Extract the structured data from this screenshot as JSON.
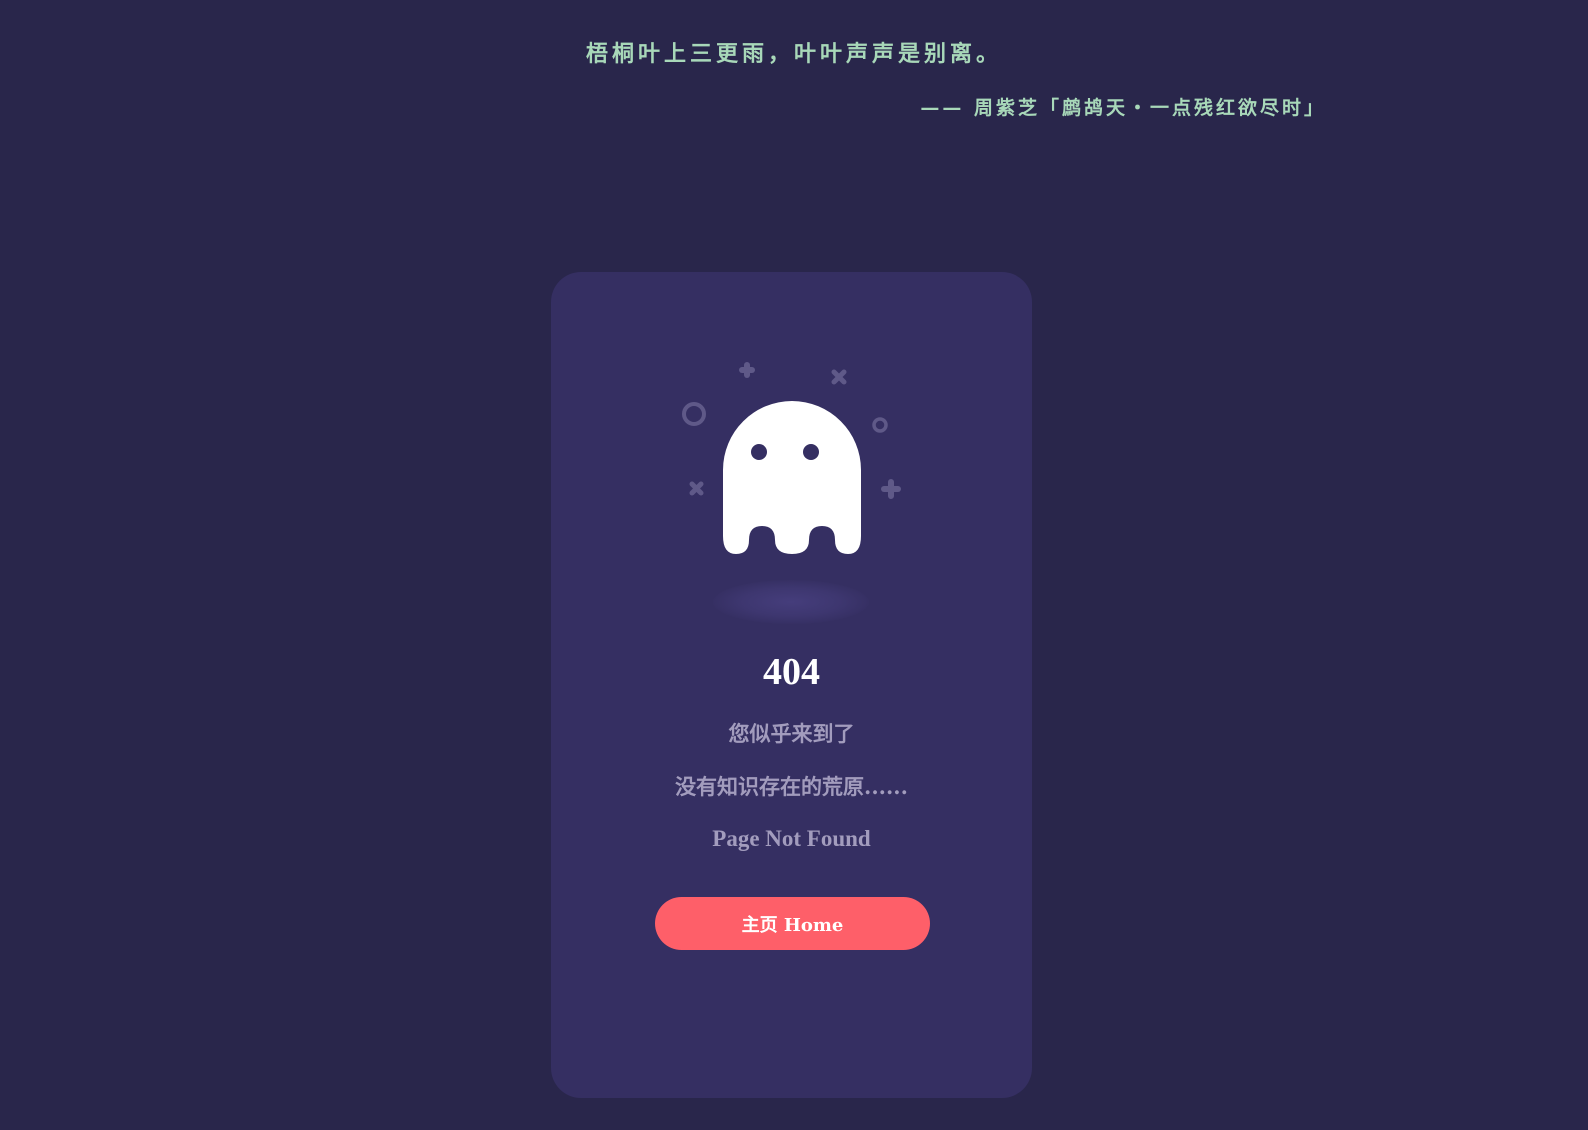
{
  "quote": {
    "text": "梧桐叶上三更雨，叶叶声声是别离。",
    "author": "—— 周紫芝「鹧鸪天・一点残红欲尽时」"
  },
  "error": {
    "code": "404",
    "line1": "您似乎来到了",
    "line2": "没有知识存在的荒原......",
    "line3": "Page Not Found"
  },
  "button": {
    "label": "主页 Home"
  },
  "colors": {
    "background": "#29264b",
    "card": "#352f62",
    "quote": "#a8d8b9",
    "accent": "#fe5f69",
    "muted_text": "#a29cbd",
    "decoration": "#5f5988"
  },
  "icons": [
    "ghost-icon",
    "plus-icon",
    "cross-icon",
    "ring-icon"
  ]
}
